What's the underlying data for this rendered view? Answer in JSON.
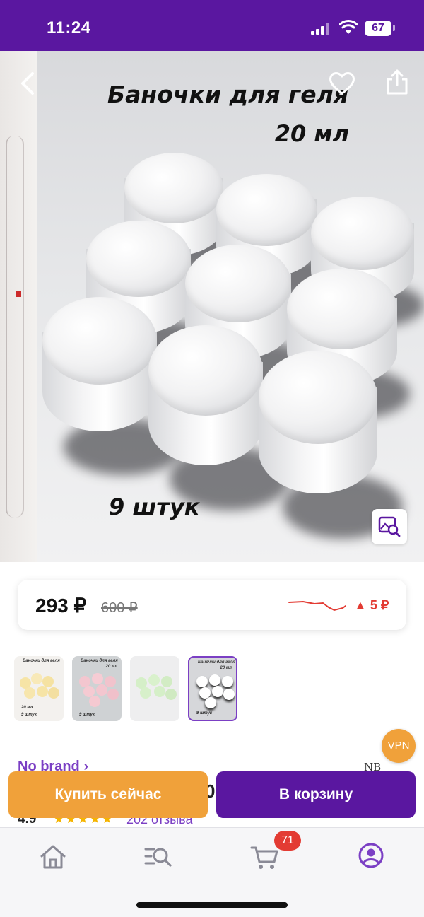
{
  "status_bar": {
    "time": "11:24",
    "battery": "67"
  },
  "hero": {
    "title": "Баночки для геля",
    "volume": "20 мл",
    "count": "9 штук",
    "back_icon": "chevron-left-icon",
    "favorite_icon": "heart-icon",
    "share_icon": "share-icon",
    "image_search_icon": "image-search-icon"
  },
  "price": {
    "current": "293 ₽",
    "old": "600 ₽",
    "change": "▲ 5 ₽",
    "change_color": "#e33b33"
  },
  "thumbnails": [
    {
      "title": "Баночки для геля",
      "sub": "20 мл",
      "count": "9 штук",
      "tint": "#f6e9b8"
    },
    {
      "title": "Баночки для геля",
      "sub": "20 мл",
      "count": "9 штук",
      "tint": "#f3c6cf"
    },
    {
      "title": "",
      "sub": "",
      "count": "",
      "tint": "#d5efc8"
    },
    {
      "title": "Баночки для геля",
      "sub": "20 мл",
      "count": "9 штук",
      "tint": "#ffffff"
    }
  ],
  "brand": {
    "link": "No brand ›",
    "logo": "NB"
  },
  "product_partial_title": "0",
  "rating": {
    "value": "4.9",
    "stars": "★★★★★",
    "reviews": "202 отзыва"
  },
  "vpn_badge": "VPN",
  "actions": {
    "buy_now": "Купить сейчас",
    "add_to_cart": "В корзину"
  },
  "bottom_nav": {
    "cart_badge": "71",
    "items": [
      "home-icon",
      "catalog-search-icon",
      "cart-icon",
      "profile-icon"
    ],
    "active_color": "#7b3fc4"
  },
  "colors": {
    "brand_purple": "#5a17a0",
    "accent_orange": "#f0a13a"
  }
}
